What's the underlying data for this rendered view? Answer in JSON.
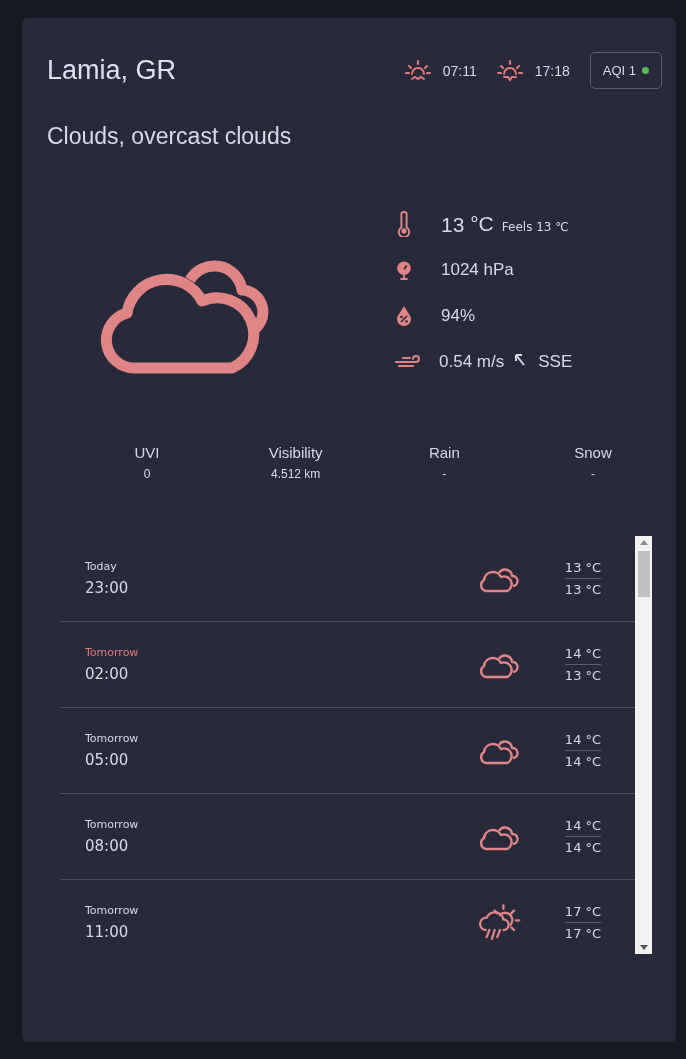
{
  "location": "Lamia, GR",
  "sunrise": "07:11",
  "sunset": "17:18",
  "aqi": {
    "label": "AQI 1",
    "color": "#5cb85c"
  },
  "description": "Clouds, overcast clouds",
  "current": {
    "temp": "13",
    "unit": "°C",
    "feels": "Feels 13 ℃",
    "pressure": "1024 hPa",
    "humidity": "94%",
    "wind": "0.54 m/s",
    "wind_dir": "SSE"
  },
  "stats": [
    {
      "label": "UVI",
      "value": "0"
    },
    {
      "label": "Visibility",
      "value": "4.512 km"
    },
    {
      "label": "Rain",
      "value": "-"
    },
    {
      "label": "Snow",
      "value": "-"
    }
  ],
  "hourly": [
    {
      "day": "Today",
      "time": "23:00",
      "kind": "clouds",
      "high": "13 °C",
      "low": "13 °C",
      "selected": false
    },
    {
      "day": "Tomorrow",
      "time": "02:00",
      "kind": "clouds",
      "high": "14 °C",
      "low": "13 °C",
      "selected": true
    },
    {
      "day": "Tomorrow",
      "time": "05:00",
      "kind": "clouds",
      "high": "14 °C",
      "low": "14 °C",
      "selected": false
    },
    {
      "day": "Tomorrow",
      "time": "08:00",
      "kind": "clouds",
      "high": "14 °C",
      "low": "14 °C",
      "selected": false
    },
    {
      "day": "Tomorrow",
      "time": "11:00",
      "kind": "rain_sun",
      "high": "17 °C",
      "low": "17 °C",
      "selected": false
    }
  ]
}
